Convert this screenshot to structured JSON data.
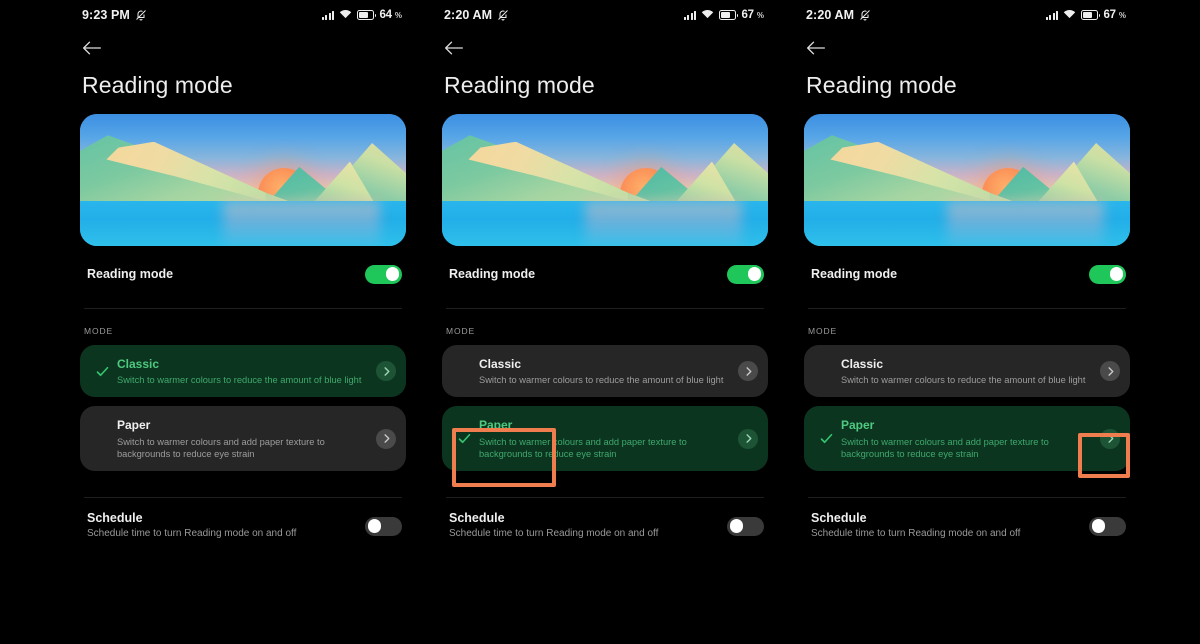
{
  "panels": [
    {
      "status_bar": {
        "time": "9:23 PM",
        "mute_icon": "bell-muted-icon",
        "signal_icon": "cellular-signal-icon",
        "wifi_icon": "wifi-icon",
        "battery_icon": "battery-icon",
        "battery_level": "64",
        "battery_unit": "%"
      },
      "back_icon": "back-arrow-icon",
      "title": "Reading mode",
      "preview_alt": "reading-mode-preview-illustration",
      "reading_mode": {
        "label": "Reading mode",
        "state": "on"
      },
      "section_label": "MODE",
      "modes": [
        {
          "title": "Classic",
          "desc": "Switch to warmer colours to reduce the amount of blue light",
          "selected": true,
          "chevron_icon": "chevron-right-icon",
          "check_icon": "check-icon"
        },
        {
          "title": "Paper",
          "desc": "Switch to warmer colours and add paper texture to backgrounds to reduce eye strain",
          "selected": false,
          "chevron_icon": "chevron-right-icon",
          "check_icon": "check-icon"
        }
      ],
      "schedule": {
        "label": "Schedule",
        "desc": "Schedule time to turn Reading mode on and off",
        "state": "off"
      }
    },
    {
      "status_bar": {
        "time": "2:20 AM",
        "mute_icon": "bell-muted-icon",
        "signal_icon": "cellular-signal-icon",
        "wifi_icon": "wifi-icon",
        "battery_icon": "battery-icon",
        "battery_level": "67",
        "battery_unit": "%"
      },
      "back_icon": "back-arrow-icon",
      "title": "Reading mode",
      "preview_alt": "reading-mode-preview-illustration",
      "reading_mode": {
        "label": "Reading mode",
        "state": "on"
      },
      "section_label": "MODE",
      "modes": [
        {
          "title": "Classic",
          "desc": "Switch to warmer colours to reduce the amount of blue light",
          "selected": false,
          "chevron_icon": "chevron-right-icon",
          "check_icon": "check-icon"
        },
        {
          "title": "Paper",
          "desc": "Switch to warmer colours and add paper texture to backgrounds to reduce eye strain",
          "selected": true,
          "chevron_icon": "chevron-right-icon",
          "check_icon": "check-icon"
        }
      ],
      "schedule": {
        "label": "Schedule",
        "desc": "Schedule time to turn Reading mode on and off",
        "state": "off"
      }
    },
    {
      "status_bar": {
        "time": "2:20 AM",
        "mute_icon": "bell-muted-icon",
        "signal_icon": "cellular-signal-icon",
        "wifi_icon": "wifi-icon",
        "battery_icon": "battery-icon",
        "battery_level": "67",
        "battery_unit": "%"
      },
      "back_icon": "back-arrow-icon",
      "title": "Reading mode",
      "preview_alt": "reading-mode-preview-illustration",
      "reading_mode": {
        "label": "Reading mode",
        "state": "on"
      },
      "section_label": "MODE",
      "modes": [
        {
          "title": "Classic",
          "desc": "Switch to warmer colours to reduce the amount of blue light",
          "selected": false,
          "chevron_icon": "chevron-right-icon",
          "check_icon": "check-icon"
        },
        {
          "title": "Paper",
          "desc": "Switch to warmer colours and add paper texture to backgrounds to reduce eye strain",
          "selected": true,
          "chevron_icon": "chevron-right-icon",
          "check_icon": "check-icon"
        }
      ],
      "schedule": {
        "label": "Schedule",
        "desc": "Schedule time to turn Reading mode on and off",
        "state": "off"
      }
    }
  ],
  "annotations": [
    {
      "name": "highlight-paper-option",
      "panel": 2,
      "target": "paper-mode-card"
    },
    {
      "name": "highlight-paper-chevron",
      "panel": 3,
      "target": "paper-mode-chevron"
    }
  ],
  "colors": {
    "background": "#000000",
    "accent_green": "#1fc75a",
    "selected_card_bg": "#0c3520",
    "selected_text": "#4ec97f",
    "unselected_card_bg": "#262626",
    "annotation_orange": "#f07d4e"
  }
}
